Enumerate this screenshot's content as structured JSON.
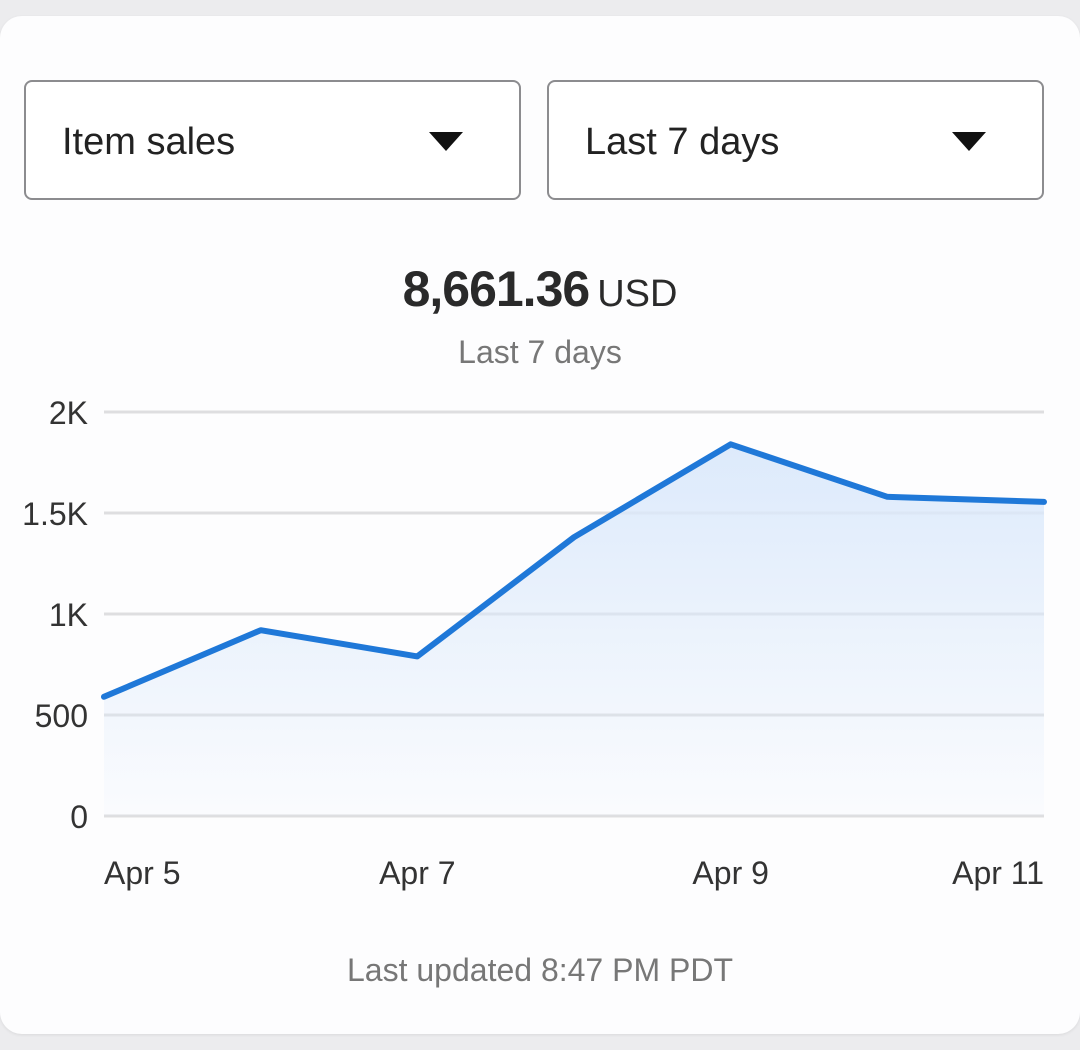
{
  "filters": {
    "metric": {
      "label": "Item sales",
      "icon": "caret-down-icon"
    },
    "range": {
      "label": "Last 7 days",
      "icon": "caret-down-icon"
    }
  },
  "summary": {
    "amount": "8,661.36",
    "currency": "USD",
    "period": "Last 7 days"
  },
  "footer": {
    "last_updated": "Last updated 8:47 PM PDT"
  },
  "colors": {
    "line": "#1f78d8",
    "grid": "#dedee0",
    "axis_text": "#333333"
  },
  "chart_data": {
    "type": "area",
    "x": [
      "Apr 5",
      "Apr 6",
      "Apr 7",
      "Apr 8",
      "Apr 9",
      "Apr 10",
      "Apr 11"
    ],
    "series": [
      {
        "values": [
          590,
          920,
          790,
          1380,
          1840,
          1580,
          1555
        ]
      }
    ],
    "x_tick_labels": [
      "Apr 5",
      "Apr 7",
      "Apr 9",
      "Apr 11"
    ],
    "y_ticks": [
      0,
      500,
      1000,
      1500,
      2000
    ],
    "y_tick_labels": [
      "0",
      "500",
      "1K",
      "1.5K",
      "2K"
    ],
    "ylim": [
      0,
      2000
    ],
    "grid": true,
    "legend": "none"
  }
}
